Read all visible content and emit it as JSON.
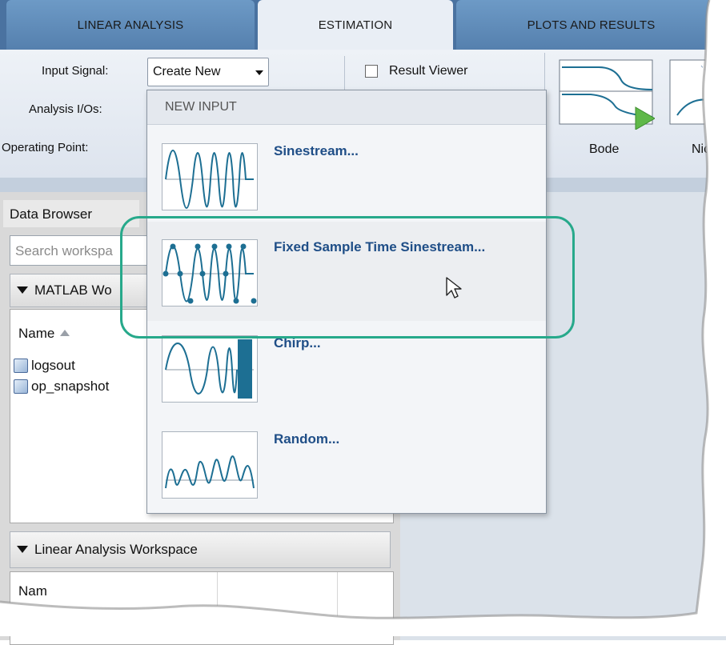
{
  "tabs": [
    {
      "label": "LINEAR ANALYSIS"
    },
    {
      "label": "ESTIMATION"
    },
    {
      "label": "PLOTS AND RESULTS"
    }
  ],
  "toolstrip": {
    "input_signal_label": "Input Signal:",
    "input_signal_value": "Create New",
    "analysis_ios_label": "Analysis I/Os:",
    "operating_point_label": "Operating Point:",
    "result_viewer_label": "Result Viewer",
    "result_viewer_checked": false,
    "plot_buttons": [
      {
        "label": "Bode",
        "icon": "bode-plot-icon"
      },
      {
        "label": "Nich",
        "icon": "nichols-plot-icon"
      }
    ]
  },
  "data_browser": {
    "title": "Data Browser",
    "search_placeholder": "Search workspa",
    "matlab_section": "MATLAB Wo",
    "column_name": "Name",
    "items": [
      {
        "name": "logsout",
        "icon": "variable-cube-icon"
      },
      {
        "name": "op_snapshot",
        "icon": "variable-cube-icon"
      }
    ],
    "linear_section": "Linear Analysis Workspace",
    "linear_column": "Nam"
  },
  "menu": {
    "header": "NEW INPUT",
    "items": [
      {
        "label": "Sinestream...",
        "icon": "sinestream-icon"
      },
      {
        "label": "Fixed Sample Time Sinestream...",
        "icon": "fixed-sample-sinestream-icon"
      },
      {
        "label": "Chirp...",
        "icon": "chirp-icon"
      },
      {
        "label": "Random...",
        "icon": "random-signal-icon"
      }
    ]
  },
  "colors": {
    "tab_inactive": "#5f8cbb",
    "tab_active": "#e9eef5",
    "menu_label": "#1f4e87",
    "highlight": "#27a98b",
    "signal": "#1d6f93"
  }
}
